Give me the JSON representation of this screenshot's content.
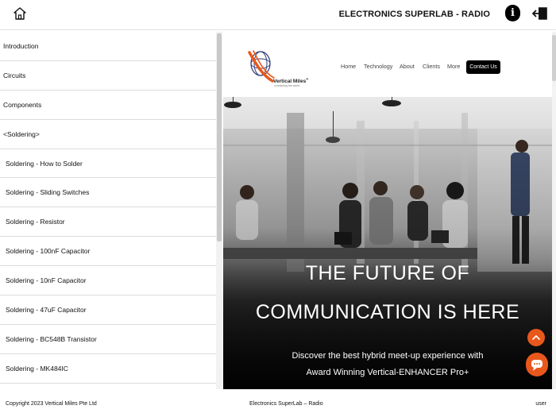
{
  "header": {
    "title": "ELECTRONICS SUPERLAB - RADIO",
    "home_icon": "home-icon",
    "info_icon": "info-icon",
    "info_glyph": "i",
    "logout_icon": "logout-icon"
  },
  "sidebar": {
    "items": [
      {
        "label": "Introduction",
        "level": "top"
      },
      {
        "label": "Circuits",
        "level": "top"
      },
      {
        "label": "Components",
        "level": "top"
      },
      {
        "label": "<Soldering>",
        "level": "top"
      },
      {
        "label": "Soldering - How to Solder",
        "level": "sub"
      },
      {
        "label": "Soldering - Sliding Switches",
        "level": "sub"
      },
      {
        "label": "Soldering - Resistor",
        "level": "sub"
      },
      {
        "label": "Soldering - 100nF Capacitor",
        "level": "sub"
      },
      {
        "label": "Soldering - 10nF Capacitor",
        "level": "sub"
      },
      {
        "label": "Soldering - 47uF Capacitor",
        "level": "sub"
      },
      {
        "label": "Soldering - BC548B Transistor",
        "level": "sub"
      },
      {
        "label": "Soldering - MK484IC",
        "level": "sub"
      }
    ]
  },
  "website": {
    "brand": "Vertical Miles",
    "brand_mark": "®",
    "tagline": "connecting the world",
    "nav": [
      "Home",
      "Technology",
      "About",
      "Clients",
      "More"
    ],
    "cta": "Contact Us",
    "hero_title_line1": "THE FUTURE OF",
    "hero_title_line2": "COMMUNICATION IS HERE",
    "hero_sub_line1": "Discover the best hybrid meet-up experience with",
    "hero_sub_line2": "Award Winning Vertical-ENHANCER Pro+",
    "scroll_top_icon": "chevron-up-icon",
    "chat_icon": "chat-icon"
  },
  "footer": {
    "copyright": "Copyright 2023 Vertical Miles Pte Ltd",
    "app_name": "Electronics SuperLab – Radio",
    "user": "user"
  },
  "colors": {
    "accent": "#e8581c",
    "hero_overlay": "#1a1a1a"
  }
}
